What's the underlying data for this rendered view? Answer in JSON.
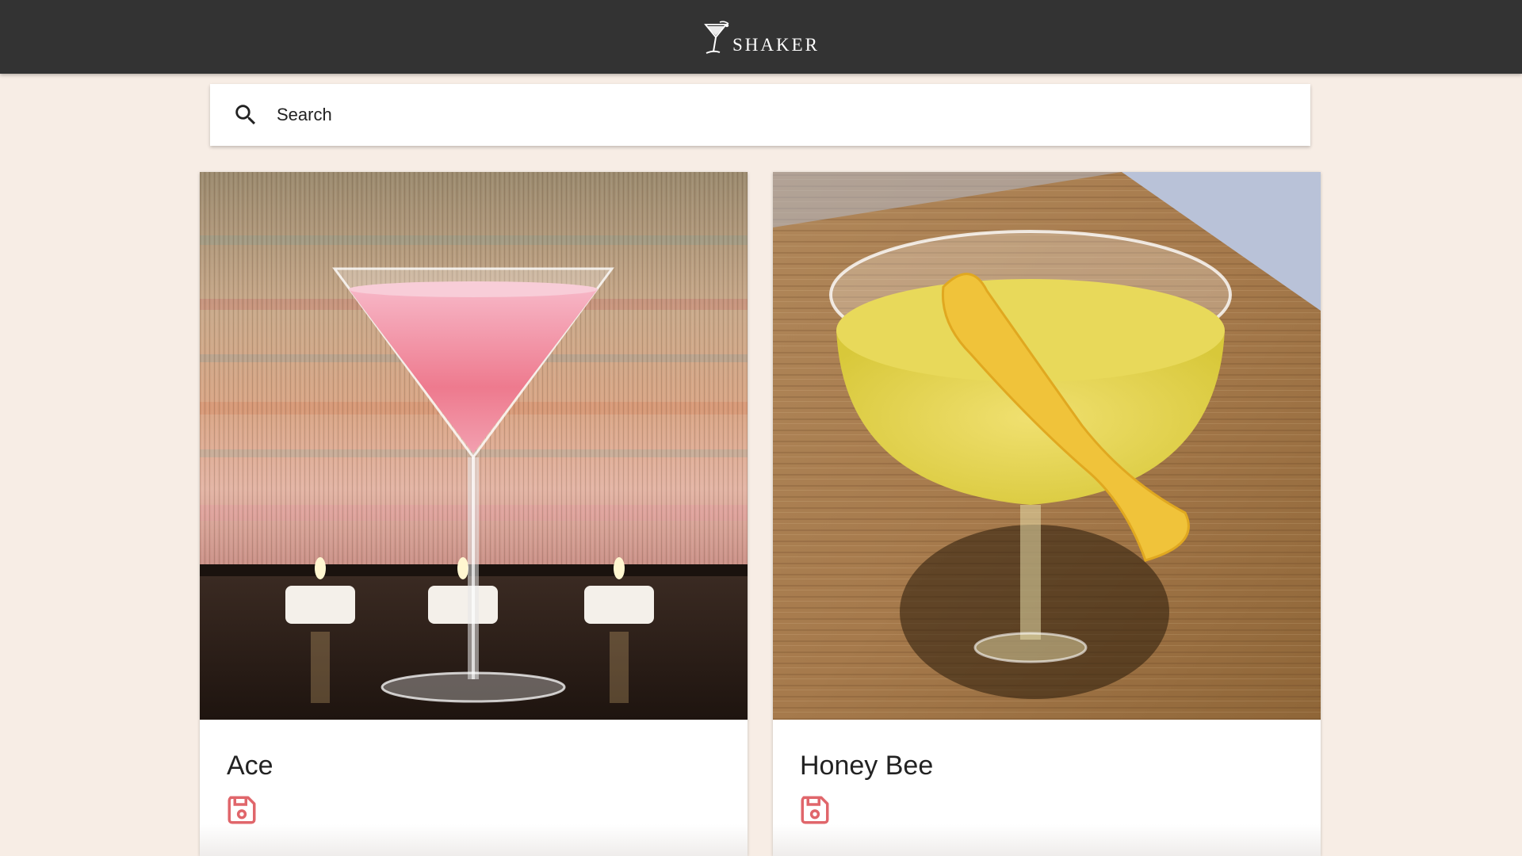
{
  "header": {
    "brand": "SHAKER",
    "logo_icon": "martini-glass-icon",
    "background": "#333333"
  },
  "search": {
    "placeholder": "Search",
    "icon": "search-icon"
  },
  "cards": [
    {
      "title": "Ace",
      "image": "pink-martini-cocktail-photo",
      "action_icon": "save-icon",
      "accent": "#e0666b"
    },
    {
      "title": "Honey Bee",
      "image": "yellow-coupe-cocktail-with-lemon-twist-photo",
      "action_icon": "save-icon",
      "accent": "#e0666b"
    }
  ],
  "colors": {
    "page_background": "#f7ede5",
    "card_background": "#ffffff",
    "icon_accent": "#e0666b"
  }
}
